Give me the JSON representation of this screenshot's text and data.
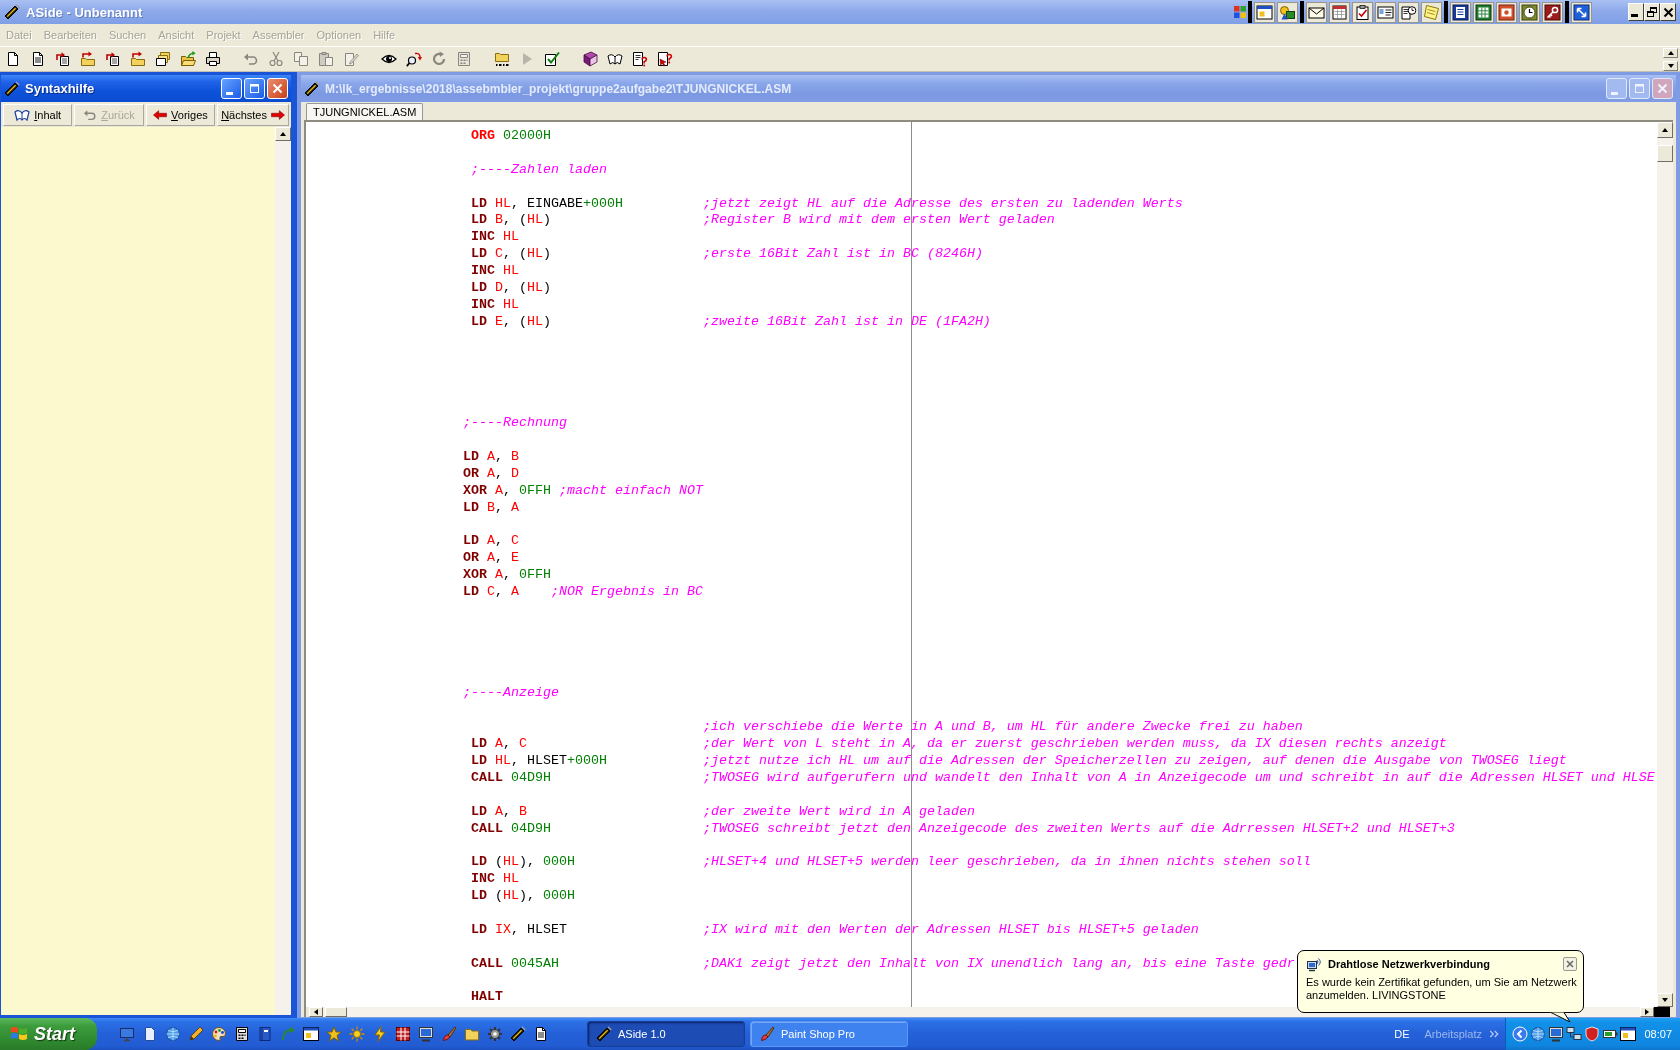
{
  "window": {
    "title": "ASide - Unbenannt"
  },
  "menu": [
    {
      "label": "Datei",
      "disabled": true
    },
    {
      "label": "Bearbeiten",
      "disabled": true
    },
    {
      "label": "Suchen",
      "disabled": true
    },
    {
      "label": "Ansicht",
      "disabled": true
    },
    {
      "label": "Projekt",
      "disabled": true
    },
    {
      "label": "Assembler",
      "disabled": true
    },
    {
      "label": "Optionen",
      "disabled": true
    },
    {
      "label": "Hilfe",
      "disabled": true
    }
  ],
  "toolbar": [
    {
      "items": [
        {
          "kind": "new",
          "disabled": false
        },
        {
          "kind": "text",
          "disabled": false
        },
        {
          "kind": "pagearrow",
          "disabled": false
        },
        {
          "kind": "folderarrow",
          "disabled": false
        },
        {
          "kind": "pagearrow",
          "disabled": false
        },
        {
          "kind": "folderarrow",
          "disabled": false
        },
        {
          "kind": "stack",
          "disabled": false
        },
        {
          "kind": "open",
          "disabled": false
        },
        {
          "kind": "print",
          "disabled": false
        }
      ]
    },
    {
      "items": [
        {
          "kind": "undo",
          "disabled": true
        },
        {
          "kind": "cut",
          "disabled": true
        },
        {
          "kind": "copy",
          "disabled": true
        },
        {
          "kind": "paste",
          "disabled": true
        },
        {
          "kind": "edit",
          "disabled": true
        }
      ]
    },
    {
      "items": [
        {
          "kind": "view",
          "disabled": false
        },
        {
          "kind": "replace",
          "disabled": false
        },
        {
          "kind": "refresh",
          "disabled": true
        },
        {
          "kind": "calc",
          "disabled": true
        }
      ]
    },
    {
      "items": [
        {
          "kind": "assemble",
          "disabled": false
        },
        {
          "kind": "run",
          "disabled": true
        },
        {
          "kind": "check",
          "disabled": false
        }
      ]
    },
    {
      "items": [
        {
          "kind": "book",
          "disabled": false
        },
        {
          "kind": "openbook",
          "disabled": false
        },
        {
          "kind": "helppage",
          "disabled": false
        },
        {
          "kind": "helppointer",
          "disabled": false
        }
      ]
    }
  ],
  "help_panel": {
    "title": "Syntaxhilfe",
    "active": true,
    "buttons": [
      {
        "label": "Inhalt",
        "kind": "contents",
        "disabled": false
      },
      {
        "label": "Zurück",
        "kind": "back",
        "disabled": true
      },
      {
        "label": "Voriges",
        "kind": "previous",
        "disabled": false
      },
      {
        "label": "Nächstes",
        "kind": "next",
        "disabled": false
      }
    ]
  },
  "editor": {
    "title": "M:\\lk_ergebnisse\\2018\\assebmbler_projekt\\gruppe2aufgabe2\\TJUNGNICKEL.ASM",
    "active": false,
    "tabs": [
      {
        "label": "TJUNGNICKEL.ASM",
        "selected": true
      }
    ],
    "lines": [
      {
        "kind": "code",
        "tokens": [
          {
            "kind": "directive",
            "text": " ORG"
          },
          {
            "kind": "number",
            "text": " 02000H"
          }
        ]
      },
      {
        "kind": "blank"
      },
      {
        "kind": "code",
        "tokens": [
          {
            "kind": "comment",
            "text": " ;----Zahlen laden"
          }
        ]
      },
      {
        "kind": "blank"
      },
      {
        "kind": "code",
        "tokens": [
          {
            "kind": "keyword",
            "text": " LD"
          },
          {
            "kind": "register",
            "text": " HL"
          },
          {
            "kind": "plain",
            "text": ", EINGABE"
          },
          {
            "kind": "number",
            "text": "+000H"
          }
        ],
        "comment": ";jetzt zeigt HL auf die Adresse des ersten zu ladenden Werts"
      },
      {
        "kind": "code",
        "tokens": [
          {
            "kind": "keyword",
            "text": " LD"
          },
          {
            "kind": "register",
            "text": " B"
          },
          {
            "kind": "plain",
            "text": ", ("
          },
          {
            "kind": "register",
            "text": "HL"
          },
          {
            "kind": "plain",
            "text": ")"
          }
        ],
        "comment": ";Register B wird mit dem ersten Wert geladen"
      },
      {
        "kind": "code",
        "tokens": [
          {
            "kind": "keyword",
            "text": " INC"
          },
          {
            "kind": "register",
            "text": " HL"
          }
        ]
      },
      {
        "kind": "code",
        "tokens": [
          {
            "kind": "keyword",
            "text": " LD"
          },
          {
            "kind": "register",
            "text": " C"
          },
          {
            "kind": "plain",
            "text": ", ("
          },
          {
            "kind": "register",
            "text": "HL"
          },
          {
            "kind": "plain",
            "text": ")"
          }
        ],
        "comment": ";erste 16Bit Zahl ist in BC (8246H)"
      },
      {
        "kind": "code",
        "tokens": [
          {
            "kind": "keyword",
            "text": " INC"
          },
          {
            "kind": "register",
            "text": " HL"
          }
        ]
      },
      {
        "kind": "code",
        "tokens": [
          {
            "kind": "keyword",
            "text": " LD"
          },
          {
            "kind": "register",
            "text": " D"
          },
          {
            "kind": "plain",
            "text": ", ("
          },
          {
            "kind": "register",
            "text": "HL"
          },
          {
            "kind": "plain",
            "text": ")"
          }
        ]
      },
      {
        "kind": "code",
        "tokens": [
          {
            "kind": "keyword",
            "text": " INC"
          },
          {
            "kind": "register",
            "text": " HL"
          }
        ]
      },
      {
        "kind": "code",
        "tokens": [
          {
            "kind": "keyword",
            "text": " LD"
          },
          {
            "kind": "register",
            "text": " E"
          },
          {
            "kind": "plain",
            "text": ", ("
          },
          {
            "kind": "register",
            "text": "HL"
          },
          {
            "kind": "plain",
            "text": ")"
          }
        ],
        "comment": ";zweite 16Bit Zahl ist in DE (1FA2H)"
      },
      {
        "kind": "blank"
      },
      {
        "kind": "blank"
      },
      {
        "kind": "blank"
      },
      {
        "kind": "blank"
      },
      {
        "kind": "blank"
      },
      {
        "kind": "code",
        "tokens": [
          {
            "kind": "comment",
            "text": ";----Rechnung"
          }
        ]
      },
      {
        "kind": "blank"
      },
      {
        "kind": "code",
        "tokens": [
          {
            "kind": "keyword",
            "text": "LD"
          },
          {
            "kind": "register",
            "text": " A"
          },
          {
            "kind": "plain",
            "text": ", "
          },
          {
            "kind": "register",
            "text": "B"
          }
        ]
      },
      {
        "kind": "code",
        "tokens": [
          {
            "kind": "keyword",
            "text": "OR"
          },
          {
            "kind": "register",
            "text": " A"
          },
          {
            "kind": "plain",
            "text": ", "
          },
          {
            "kind": "register",
            "text": "D"
          }
        ]
      },
      {
        "kind": "code",
        "tokens": [
          {
            "kind": "keyword",
            "text": "XOR"
          },
          {
            "kind": "register",
            "text": " A"
          },
          {
            "kind": "plain",
            "text": ", "
          },
          {
            "kind": "number",
            "text": "0FFH"
          },
          {
            "kind": "comment",
            "text": " ;macht einfach NOT"
          }
        ]
      },
      {
        "kind": "code",
        "tokens": [
          {
            "kind": "keyword",
            "text": "LD"
          },
          {
            "kind": "register",
            "text": " B"
          },
          {
            "kind": "plain",
            "text": ", "
          },
          {
            "kind": "register",
            "text": "A"
          }
        ]
      },
      {
        "kind": "blank"
      },
      {
        "kind": "code",
        "tokens": [
          {
            "kind": "keyword",
            "text": "LD"
          },
          {
            "kind": "register",
            "text": " A"
          },
          {
            "kind": "plain",
            "text": ", "
          },
          {
            "kind": "register",
            "text": "C"
          }
        ]
      },
      {
        "kind": "code",
        "tokens": [
          {
            "kind": "keyword",
            "text": "OR"
          },
          {
            "kind": "register",
            "text": " A"
          },
          {
            "kind": "plain",
            "text": ", "
          },
          {
            "kind": "register",
            "text": "E"
          }
        ]
      },
      {
        "kind": "code",
        "tokens": [
          {
            "kind": "keyword",
            "text": "XOR"
          },
          {
            "kind": "register",
            "text": " A"
          },
          {
            "kind": "plain",
            "text": ", "
          },
          {
            "kind": "number",
            "text": "0FFH"
          }
        ]
      },
      {
        "kind": "code",
        "tokens": [
          {
            "kind": "keyword",
            "text": "LD"
          },
          {
            "kind": "register",
            "text": " C"
          },
          {
            "kind": "plain",
            "text": ", "
          },
          {
            "kind": "register",
            "text": "A"
          },
          {
            "kind": "comment",
            "text": "    ;NOR Ergebnis in BC"
          }
        ]
      },
      {
        "kind": "blank"
      },
      {
        "kind": "blank"
      },
      {
        "kind": "blank"
      },
      {
        "kind": "blank"
      },
      {
        "kind": "blank"
      },
      {
        "kind": "code",
        "tokens": [
          {
            "kind": "comment",
            "text": ";----Anzeige"
          }
        ]
      },
      {
        "kind": "blank"
      },
      {
        "kind": "code",
        "comment": ";ich verschiebe die Werte in A und B, um HL für andere Zwecke frei zu haben"
      },
      {
        "kind": "code",
        "tokens": [
          {
            "kind": "keyword",
            "text": " LD"
          },
          {
            "kind": "register",
            "text": " A"
          },
          {
            "kind": "plain",
            "text": ", "
          },
          {
            "kind": "register",
            "text": "C"
          }
        ],
        "comment": ";der Wert von L steht in A, da er zuerst geschrieben werden muss, da IX diesen rechts anzeigt"
      },
      {
        "kind": "code",
        "tokens": [
          {
            "kind": "keyword",
            "text": " LD"
          },
          {
            "kind": "register",
            "text": " HL"
          },
          {
            "kind": "plain",
            "text": ", HLSET"
          },
          {
            "kind": "number",
            "text": "+000H"
          }
        ],
        "comment": ";jetzt nutze ich HL um auf die Adressen der Speicherzellen zu zeigen, auf denen die Ausgabe von TWOSEG liegt"
      },
      {
        "kind": "code",
        "tokens": [
          {
            "kind": "keyword",
            "text": " CALL"
          },
          {
            "kind": "number",
            "text": " 04D9H"
          }
        ],
        "comment": ";TWOSEG wird aufgerufern und wandelt den Inhalt von A in Anzeigecode um und schreibt in auf die Adressen HLSET und HLSE"
      },
      {
        "kind": "blank"
      },
      {
        "kind": "code",
        "tokens": [
          {
            "kind": "keyword",
            "text": " LD"
          },
          {
            "kind": "register",
            "text": " A"
          },
          {
            "kind": "plain",
            "text": ", "
          },
          {
            "kind": "register",
            "text": "B"
          }
        ],
        "comment": ";der zweite Wert wird in A geladen"
      },
      {
        "kind": "code",
        "tokens": [
          {
            "kind": "keyword",
            "text": " CALL"
          },
          {
            "kind": "number",
            "text": " 04D9H"
          }
        ],
        "comment": ";TWOSEG schreibt jetzt den Anzeigecode des zweiten Werts auf die Adrressen HLSET+2 und HLSET+3"
      },
      {
        "kind": "blank"
      },
      {
        "kind": "code",
        "tokens": [
          {
            "kind": "keyword",
            "text": " LD"
          },
          {
            "kind": "plain",
            "text": " ("
          },
          {
            "kind": "register",
            "text": "HL"
          },
          {
            "kind": "plain",
            "text": "), "
          },
          {
            "kind": "number",
            "text": "000H"
          }
        ],
        "comment": ";HLSET+4 und HLSET+5 werden leer geschrieben, da in ihnen nichts stehen soll"
      },
      {
        "kind": "code",
        "tokens": [
          {
            "kind": "keyword",
            "text": " INC"
          },
          {
            "kind": "register",
            "text": " HL"
          }
        ]
      },
      {
        "kind": "code",
        "tokens": [
          {
            "kind": "keyword",
            "text": " LD"
          },
          {
            "kind": "plain",
            "text": " ("
          },
          {
            "kind": "register",
            "text": "HL"
          },
          {
            "kind": "plain",
            "text": "), "
          },
          {
            "kind": "number",
            "text": "000H"
          }
        ]
      },
      {
        "kind": "blank"
      },
      {
        "kind": "code",
        "tokens": [
          {
            "kind": "keyword",
            "text": " LD"
          },
          {
            "kind": "register",
            "text": " IX"
          },
          {
            "kind": "plain",
            "text": ", HLSET"
          }
        ],
        "comment": ";IX wird mit den Werten der Adressen HLSET bis HLSET+5 geladen"
      },
      {
        "kind": "blank"
      },
      {
        "kind": "code",
        "tokens": [
          {
            "kind": "keyword",
            "text": " CALL"
          },
          {
            "kind": "number",
            "text": " 0045AH"
          }
        ],
        "comment": ";DAK1 zeigt jetzt den Inhalt von IX unendlich lang an, bis eine Taste gedr"
      },
      {
        "kind": "blank"
      },
      {
        "kind": "code",
        "tokens": [
          {
            "kind": "keyword",
            "text": " HALT"
          }
        ]
      }
    ]
  },
  "taskbar": {
    "start": "Start",
    "tasks": [
      {
        "label": "ASide 1.0",
        "kind": "assembler",
        "selected": true
      },
      {
        "label": "Paint Shop Pro",
        "kind": "painter",
        "selected": false
      }
    ],
    "language": "DE",
    "toolbar_label": "Arbeitsplatz",
    "clock": "08:07"
  },
  "notification": {
    "title": "Drahtlose Netzwerkverbindung",
    "body": "Es wurde kein Zertifikat gefunden, um Sie am Netzwerk anzumelden. LIVINGSTONE"
  }
}
